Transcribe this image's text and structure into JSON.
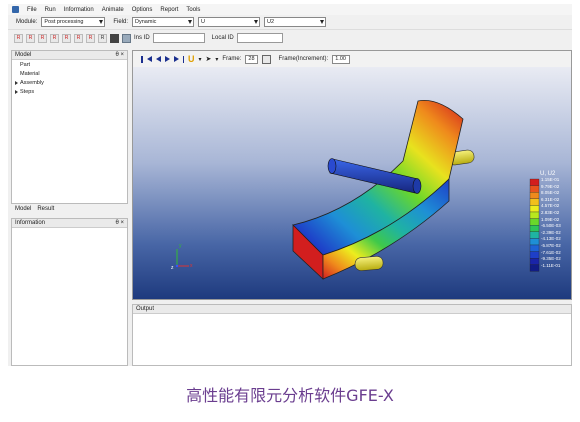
{
  "menu": [
    "File",
    "Run",
    "Information",
    "Animate",
    "Options",
    "Report",
    "Tools"
  ],
  "toolbar1": {
    "module_label": "Module:",
    "module_value": "Post processing",
    "field_label": "Field:",
    "field_value": "Dynamic",
    "var_value": "U",
    "comp_value": "U2"
  },
  "toolbar2": {
    "icons": [
      "rp1",
      "rp2",
      "rp3",
      "rp4",
      "rp5",
      "rp6",
      "rp7",
      "rp8"
    ],
    "ins_label": "Ins ID",
    "local_label": "Local ID"
  },
  "model_panel": {
    "title": "Model",
    "controls": "θ ×",
    "items": [
      {
        "label": "Part",
        "expandable": false
      },
      {
        "label": "Material",
        "expandable": false
      },
      {
        "label": "Assembly",
        "expandable": true
      },
      {
        "label": "Steps",
        "expandable": true
      }
    ]
  },
  "tabs": [
    "Model",
    "Result"
  ],
  "info_panel": {
    "title": "Information",
    "controls": "θ ×"
  },
  "viewport": {
    "frame_label": "Frame:",
    "frame_value": "28",
    "time_label": "Frame(Increment):",
    "time_value": "1.00",
    "legend_title": "U, U2",
    "legend_values": [
      "1.15E-01",
      "9.79E-02",
      "8.05E-02",
      "6.31E-02",
      "4.57E-02",
      "2.83E-02",
      "1.09E-02",
      "-6.50E-03",
      "-2.39E-02",
      "-4.13E-02",
      "-5.87E-02",
      "-7.61E-02",
      "-9.35E-02",
      "-1.11E-01"
    ],
    "legend_colors": [
      "#d21e1e",
      "#e8531d",
      "#ef8a1c",
      "#f2c01b",
      "#eded1e",
      "#b9e81e",
      "#6ad72a",
      "#2ec45a",
      "#1fb3a2",
      "#1e8fd6",
      "#1e63d6",
      "#1e3fc8",
      "#1a24a8",
      "#111c86"
    ],
    "axes": {
      "x": "x",
      "y": "y",
      "z": "z"
    }
  },
  "output_panel": {
    "title": "Output"
  },
  "caption": "高性能有限元分析软件GFE-X",
  "colors": {
    "caption": "#6a3d8f",
    "accent": "#1b2f8e"
  }
}
